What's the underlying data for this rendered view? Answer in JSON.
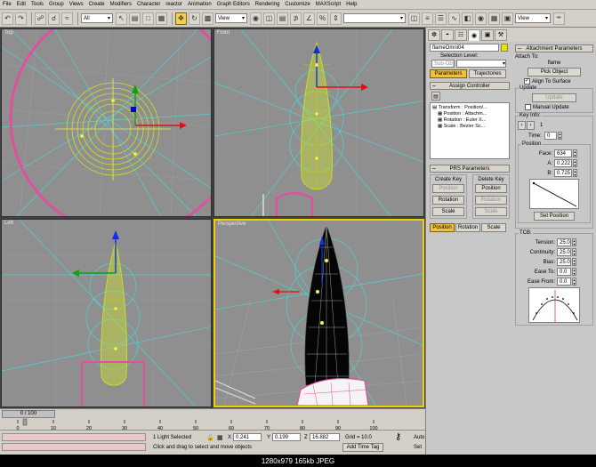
{
  "menu": [
    "File",
    "Edit",
    "Tools",
    "Group",
    "Views",
    "Create",
    "Modifiers",
    "Character",
    "reactor",
    "Animation",
    "Graph Editors",
    "Rendering",
    "Customize",
    "MAXScript",
    "Help"
  ],
  "toolbar": {
    "selection_filter": "All",
    "coord_system": "View",
    "view_dropdown": "View"
  },
  "viewports": {
    "top": "Top",
    "front": "Front",
    "left": "Left",
    "perspective": "Perspective"
  },
  "timeline": {
    "frame_counter": "0 / 100",
    "ticks": [
      "0",
      "10",
      "20",
      "30",
      "40",
      "50",
      "60",
      "70",
      "80",
      "90",
      "100"
    ]
  },
  "status": {
    "selection": "1 Light Selected",
    "prompt": "Click and drag to select and move objects",
    "x_label": "X",
    "x_value": "0.241",
    "y_label": "Y",
    "y_value": "0.199",
    "z_label": "Z",
    "z_value": "16.882",
    "grid": "Grid = 10.0",
    "add_time_tag": "Add Time Tag",
    "auto_key": "Auto",
    "set_key": "Set"
  },
  "cmd_panel": {
    "tabs": [
      "❆",
      "◓",
      "☷",
      "◉",
      "▣",
      "⚒"
    ],
    "object_name": "flameOmni04",
    "selection_level_label": "Selection Level:",
    "selection_level_value": "Sub-Object",
    "parameters_tab": "Parameters",
    "trajectories_tab": "Trajectories",
    "assign_controller_title": "Assign Controller",
    "controller_tree": [
      "Transform : Position/...",
      "Position : Attachm...",
      "Rotation : Euler X...",
      "Scale : Bezier Sc..."
    ],
    "prs_title": "PRS Parameters",
    "create_key_label": "Create Key",
    "delete_key_label": "Delete Key",
    "create_position": "Position",
    "create_rotation": "Rotation",
    "create_scale": "Scale",
    "delete_position": "Position",
    "delete_rotation": "Rotation",
    "delete_scale": "Scale",
    "bottom_position": "Position",
    "bottom_rotation": "Rotation",
    "bottom_scale": "Scale",
    "attachment_title": "Attachment Parameters",
    "attach_to_label": "Attach To:",
    "attach_target": "flame",
    "pick_object": "Pick Object",
    "align_to_surface": "Align To Surface",
    "update_label": "Update",
    "update_button": "Update",
    "manual_update": "Manual Update",
    "key_info_label": "Key Info:",
    "key_number": "1",
    "time_label": "Time:",
    "time_value": "0",
    "position_label": "Position",
    "face_label": "Face:",
    "face_value": "634",
    "a_label": "A:",
    "a_value": "0.222",
    "b_label": "B:",
    "b_value": "0.725",
    "set_position": "Set Position",
    "tcb_label": "TCB:",
    "tension_label": "Tension:",
    "tension_value": "25.0",
    "continuity_label": "Continuity:",
    "continuity_value": "25.0",
    "bias_label": "Bias:",
    "bias_value": "25.0",
    "ease_to_label": "Ease To:",
    "ease_to_value": "0.0",
    "ease_from_label": "Ease From:",
    "ease_from_value": "0.0"
  },
  "caption": "1280x979  165kb  JPEG",
  "colors": {
    "active_viewport": "#f0d000",
    "viewport_bg": "#8f8f8f",
    "accent_button": "#f0c040"
  }
}
